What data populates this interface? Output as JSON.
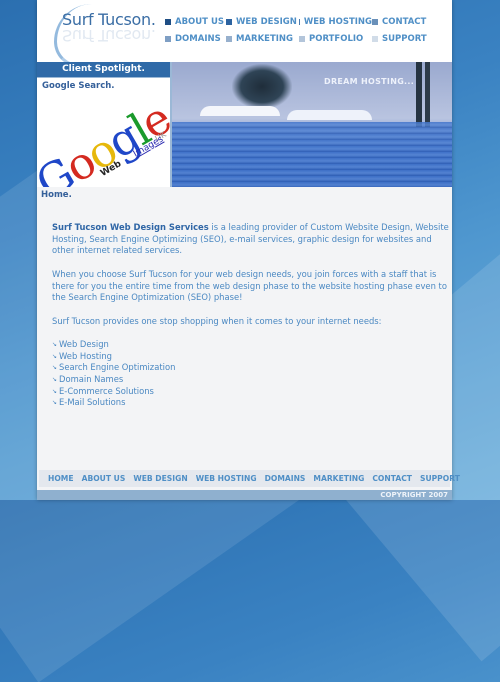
{
  "site": {
    "logo_text": "Surf Tucson."
  },
  "top_nav": {
    "rows": [
      [
        {
          "label": "ABOUT US",
          "color": "#1f4e84"
        },
        {
          "label": "WEB DESIGN",
          "color": "#2d63a0"
        },
        {
          "label": "WEB HOSTING",
          "color": "#4a7aad"
        },
        {
          "label": "CONTACT",
          "color": "#6a90b9"
        }
      ],
      [
        {
          "label": "DOMAINS",
          "color": "#7f9fc4"
        },
        {
          "label": "MARKETING",
          "color": "#97b0cd"
        },
        {
          "label": "PORTFOLIO",
          "color": "#b3c5da"
        },
        {
          "label": "SUPPORT",
          "color": "#d1dce8"
        }
      ]
    ]
  },
  "spotlight": {
    "title": "Client Spotlight.",
    "subtitle": "Google Search.",
    "image": {
      "word": [
        "G",
        "o",
        "o",
        "g",
        "l",
        "e"
      ],
      "region": "UK",
      "tab_web": "Web",
      "tab_images": "Images"
    }
  },
  "hero": {
    "caption": "DREAM HOSTING..."
  },
  "breadcrumb": "Home.",
  "content": {
    "intro_bold": "Surf Tucson Web Design Services",
    "intro_rest": " is a leading provider of Custom Website Design, Website Hosting, Search Engine Optimizing (SEO), e-mail services, graphic design for websites and other internet related services.",
    "para2": "When you choose Surf Tucson for your web design needs, you join forces with a staff that is there for you the entire time from the web design phase to the website hosting phase even to the Search Engine Optimization (SEO) phase!",
    "para3": "Surf Tucson provides one stop shopping when it comes to your internet needs:",
    "services": [
      "Web Design",
      "Web Hosting",
      "Search Engine Optimization",
      "Domain Names",
      "E-Commerce Solutions",
      "E-Mail Solutions"
    ]
  },
  "footer_nav": [
    "HOME",
    "ABOUT US",
    "WEB DESIGN",
    "WEB HOSTING",
    "DOMAINS",
    "MARKETING",
    "CONTACT",
    "SUPPORT"
  ],
  "copyright": "COPYRIGHT 2007"
}
